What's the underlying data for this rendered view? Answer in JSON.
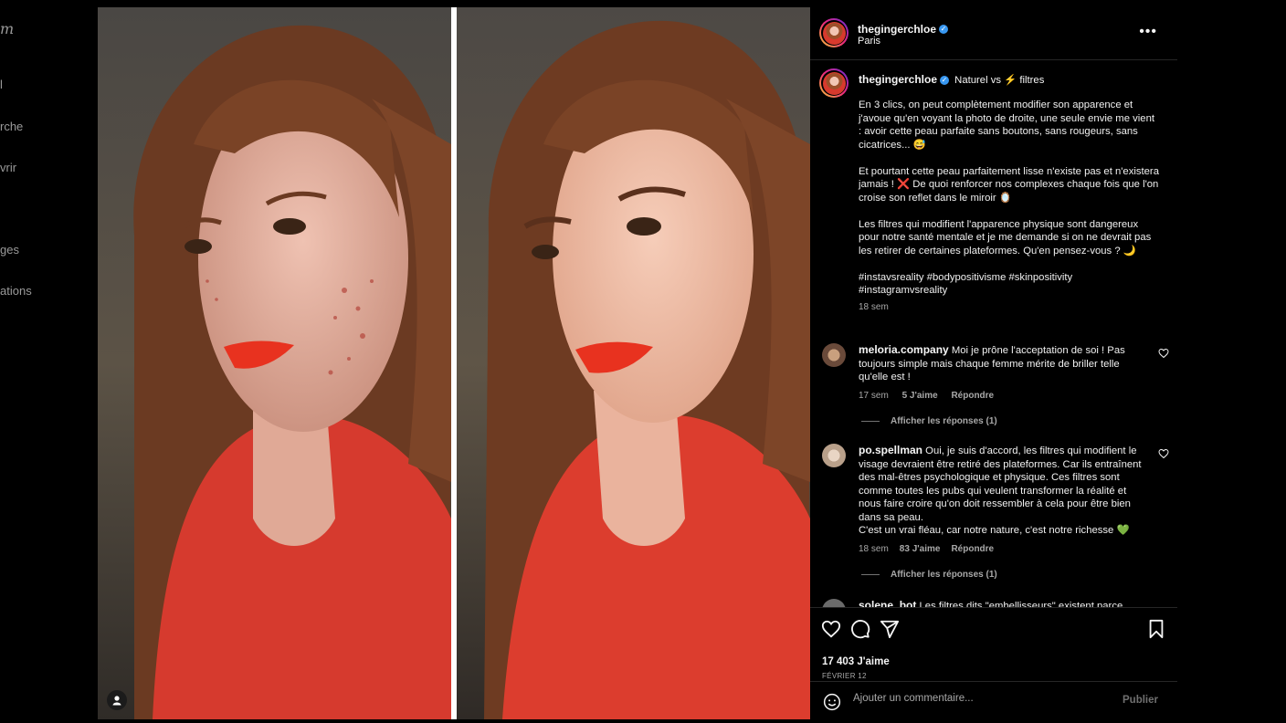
{
  "nav": {
    "logo": "m",
    "items": [
      {
        "label": "l",
        "icon": "home-icon"
      },
      {
        "label": "rche",
        "icon": "search-icon"
      },
      {
        "label": "vrir",
        "icon": "explore-icon"
      },
      {
        "label": "ges",
        "icon": "messages-icon"
      },
      {
        "label": "ations",
        "icon": "notifications-icon"
      }
    ]
  },
  "post": {
    "username": "thegingerchloe",
    "location": "Paris",
    "more_label": "•••",
    "caption": {
      "title": "Naturel vs ⚡ filtres",
      "paragraphs": [
        "En 3 clics, on peut complètement modifier son apparence et j'avoue qu'en voyant la photo de droite, une seule envie me vient : avoir cette peau parfaite sans boutons, sans rougeurs, sans cicatrices... 😅",
        "Et pourtant cette peau parfaitement lisse n'existe pas et n'existera jamais ! ❌ De quoi renforcer nos complexes chaque fois que l'on croise son reflet dans le miroir 🪞",
        "Les filtres qui modifient l'apparence physique sont dangereux pour notre santé mentale et je me demande si on ne devrait pas les retirer de certaines plateformes. Qu'en pensez-vous ? 🌙",
        "#instavsreality #bodypositivisme #skinpositivity #instagramvsreality"
      ],
      "time": "18 sem"
    },
    "comments": [
      {
        "username": "meloria.company",
        "text": "Moi je prône l'acceptation de soi ! Pas toujours simple mais chaque femme mérite de briller telle qu'elle est !",
        "time": "17 sem",
        "likes": "5 J'aime",
        "reply": "Répondre",
        "view_replies": "Afficher les réponses (1)"
      },
      {
        "username": "po.spellman",
        "text": "Oui, je suis d'accord, les filtres qui modifient le visage devraient être retiré des plateformes. Car ils entraînent des mal-êtres psychologique et physique. Ces filtres sont comme toutes les pubs qui veulent transformer la réalité et nous faire croire qu'on doit ressembler à cela pour être bien dans sa peau.\nC'est un vrai fléau, car notre nature, c'est notre richesse 💚",
        "time": "18 sem",
        "likes": "83 J'aime",
        "reply": "Répondre",
        "view_replies": "Afficher les réponses (1)"
      },
      {
        "username": "solene_bot",
        "text": "Les filtres dits \"embellisseurs\" existent parce"
      }
    ],
    "likes_count": "17 403 J'aime",
    "date": "FÉVRIER 12",
    "add_comment": {
      "placeholder": "Ajouter un commentaire...",
      "publish": "Publier"
    }
  },
  "colors": {
    "verified": "#3897f0",
    "background": "#000000",
    "muted_text": "#a8a8a8",
    "dress_red": "#d8392d",
    "lip_red": "#e8321f"
  }
}
